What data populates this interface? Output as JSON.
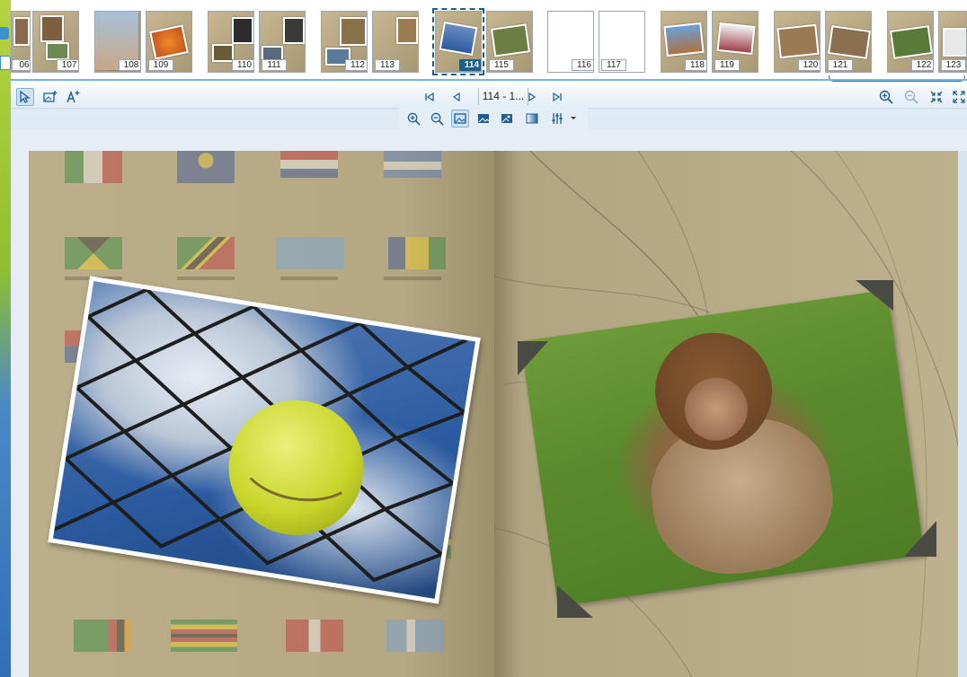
{
  "thumbnails": [
    {
      "label": "06"
    },
    {
      "label": "107"
    },
    {
      "label": "108"
    },
    {
      "label": "109"
    },
    {
      "label": "110"
    },
    {
      "label": "111"
    },
    {
      "label": "112"
    },
    {
      "label": "113"
    },
    {
      "label": "114",
      "selected": true
    },
    {
      "label": "115"
    },
    {
      "label": "116",
      "blank": true
    },
    {
      "label": "117",
      "blank": true
    },
    {
      "label": "118"
    },
    {
      "label": "119"
    },
    {
      "label": "120"
    },
    {
      "label": "121"
    },
    {
      "label": "122"
    },
    {
      "label": "123"
    }
  ],
  "toolbar": {
    "page_indicator": "114 - 1...",
    "icons": [
      "select-arrow-icon",
      "add-image-icon",
      "add-text-icon",
      "first-page-icon",
      "prev-page-icon",
      "next-page-icon",
      "last-page-icon",
      "zoom-in-icon",
      "zoom-out-icon",
      "fit-page-icon",
      "fullscreen-icon"
    ]
  },
  "sub_toolbar": {
    "icons": [
      "zoom-in-icon",
      "zoom-out-icon",
      "image-fit-icon",
      "image-fill-icon",
      "image-replace-icon",
      "gradient-icon",
      "adjust-icon",
      "dropdown-icon"
    ]
  },
  "colors": {
    "accent": "#1a5e94",
    "page_bg": "#b9ab87"
  },
  "canvas": {
    "left_page": "flags-background",
    "right_page": "old-map-background"
  }
}
